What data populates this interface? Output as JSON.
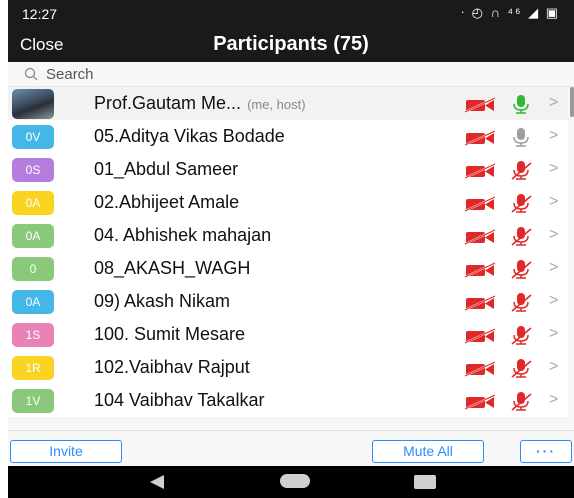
{
  "status_bar": {
    "time": "12:27",
    "icons_text": "ᐧ ◴ ∩ ⁴⁶ ◢ ▣"
  },
  "header": {
    "close_label": "Close",
    "title": "Participants (75)"
  },
  "search": {
    "placeholder": "Search"
  },
  "participants": [
    {
      "initials": "",
      "name": "Prof.Gautam Me...",
      "role": "(me, host)",
      "avatar_color": "#555555",
      "video": "off",
      "mic": "on"
    },
    {
      "initials": "0V",
      "name": "05.Aditya Vikas Bodade",
      "role": "",
      "avatar_color": "#45b7e6",
      "video": "off",
      "mic": "unmuted-idle"
    },
    {
      "initials": "0S",
      "name": "01_Abdul Sameer",
      "role": "",
      "avatar_color": "#b57edc",
      "video": "off",
      "mic": "muted"
    },
    {
      "initials": "0A",
      "name": "02.Abhijeet Amale",
      "role": "",
      "avatar_color": "#f9d423",
      "video": "off",
      "mic": "muted"
    },
    {
      "initials": "0A",
      "name": "04. Abhishek mahajan",
      "role": "",
      "avatar_color": "#8bc97a",
      "video": "off",
      "mic": "muted"
    },
    {
      "initials": "0",
      "name": "08_AKASH_WAGH",
      "role": "",
      "avatar_color": "#8bc97a",
      "video": "off",
      "mic": "muted"
    },
    {
      "initials": "0A",
      "name": "09) Akash Nikam",
      "role": "",
      "avatar_color": "#45b7e6",
      "video": "off",
      "mic": "muted"
    },
    {
      "initials": "1S",
      "name": "100. Sumit Mesare",
      "role": "",
      "avatar_color": "#e982b5",
      "video": "off",
      "mic": "muted"
    },
    {
      "initials": "1R",
      "name": "102.Vaibhav Rajput",
      "role": "",
      "avatar_color": "#f9d423",
      "video": "off",
      "mic": "muted"
    },
    {
      "initials": "1V",
      "name": "104 Vaibhav Takalkar",
      "role": "",
      "avatar_color": "#8bc97a",
      "video": "off",
      "mic": "muted"
    }
  ],
  "footer": {
    "invite_label": "Invite",
    "mute_all_label": "Mute All",
    "more_label": "···"
  },
  "colors": {
    "video_off": "#e02828",
    "mic_on": "#2eb82e",
    "mic_idle": "#9e9e9e",
    "mic_muted": "#e02828",
    "accent": "#2d8cff"
  }
}
